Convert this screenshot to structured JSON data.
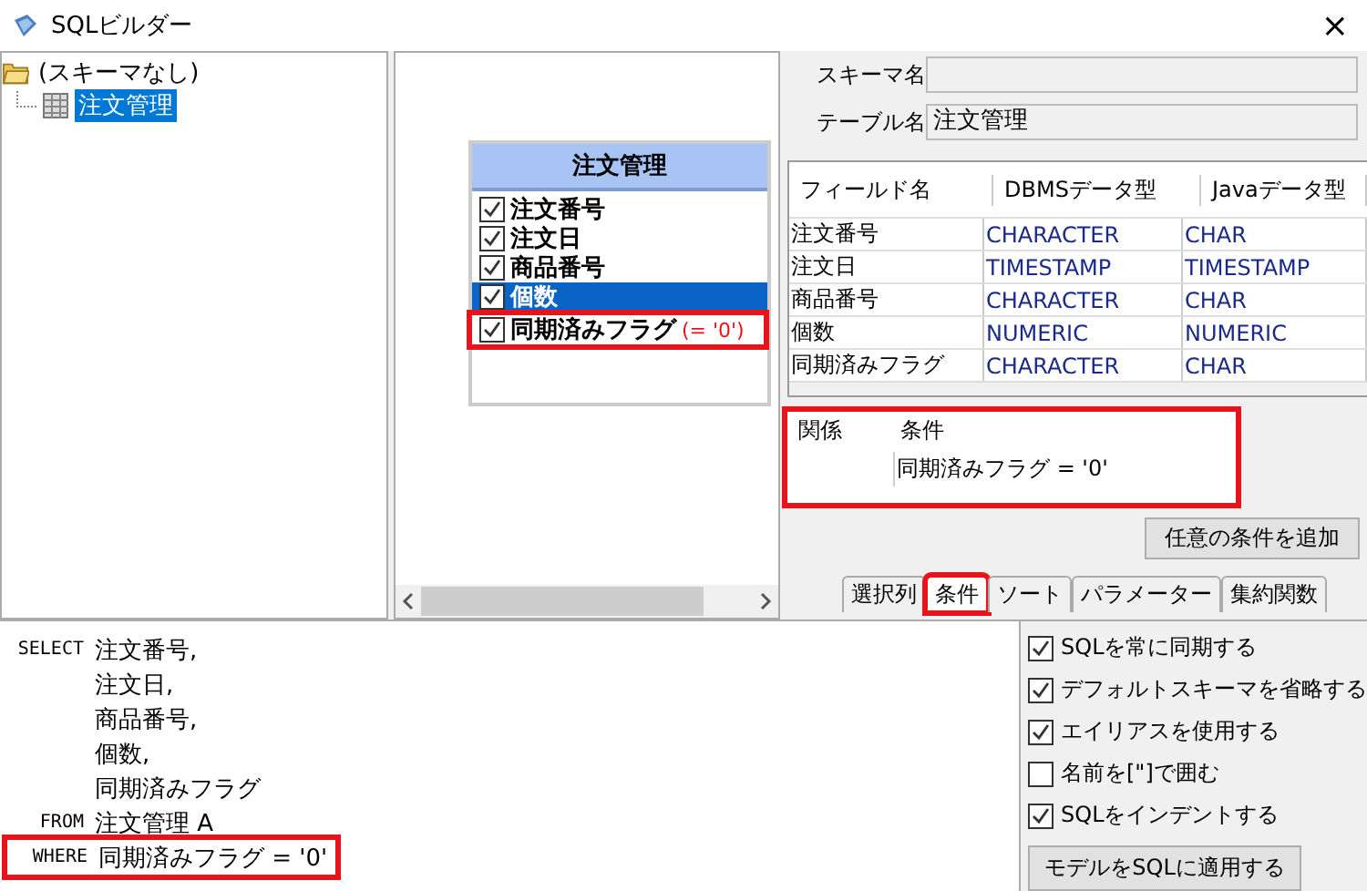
{
  "window": {
    "title": "SQLビルダー",
    "close": "×"
  },
  "tree": {
    "label": "(スキーマなし)",
    "children": [
      {
        "label": "注文管理",
        "selected": true
      }
    ]
  },
  "entity": {
    "title": "注文管理",
    "fields": [
      {
        "label": "注文番号",
        "checked": true,
        "selected": false
      },
      {
        "label": "注文日",
        "checked": true,
        "selected": false
      },
      {
        "label": "商品番号",
        "checked": true,
        "selected": false
      },
      {
        "label": "個数",
        "checked": true,
        "selected": true
      },
      {
        "label": "同期済みフラグ",
        "checked": true,
        "selected": false,
        "condition": "(= '0')",
        "highlighted": true
      }
    ]
  },
  "properties": {
    "schema_label": "スキーマ名",
    "table_label": "テーブル名",
    "table_value": "注文管理"
  },
  "fields_table": {
    "columns": [
      "フィールド名",
      "DBMSデータ型",
      "Javaデータ型"
    ],
    "rows": [
      [
        "注文番号",
        "CHARACTER",
        "CHAR"
      ],
      [
        "注文日",
        "TIMESTAMP",
        "TIMESTAMP"
      ],
      [
        "商品番号",
        "CHARACTER",
        "CHAR"
      ],
      [
        "個数",
        "NUMERIC",
        "NUMERIC"
      ],
      [
        "同期済みフラグ",
        "CHARACTER",
        "CHAR"
      ]
    ]
  },
  "conditions": {
    "highlighted": true,
    "columns": [
      "関係",
      "条件"
    ],
    "rows": [
      {
        "condition": "同期済みフラグ = '0'"
      }
    ]
  },
  "add_condition_button": "任意の条件を追加",
  "tabs": [
    {
      "label": "選択列",
      "selected": false,
      "highlighted": false
    },
    {
      "label": "条件",
      "selected": true,
      "highlighted": true
    },
    {
      "label": "ソート",
      "selected": false,
      "highlighted": false
    },
    {
      "label": "パラメーター",
      "selected": false,
      "highlighted": false
    },
    {
      "label": "集約関数",
      "selected": false,
      "highlighted": false
    }
  ],
  "sql": [
    {
      "keyword": "SELECT",
      "text": "注文番号,"
    },
    {
      "text": "注文日,"
    },
    {
      "text": "商品番号,"
    },
    {
      "text": "個数,"
    },
    {
      "text": "同期済みフラグ"
    },
    {
      "keyword": "FROM",
      "text": "注文管理 A"
    },
    {
      "keyword": "WHERE",
      "text": "同期済みフラグ = '0'",
      "highlighted": true
    }
  ],
  "options": [
    {
      "label": "SQLを常に同期する",
      "checked": true
    },
    {
      "label": "デフォルトスキーマを省略する",
      "checked": true
    },
    {
      "label": "エイリアスを使用する",
      "checked": true
    },
    {
      "label": "名前を[\"]で囲む",
      "checked": false
    },
    {
      "label": "SQLをインデントする",
      "checked": true
    }
  ],
  "apply_button": "モデルをSQLに適用する"
}
